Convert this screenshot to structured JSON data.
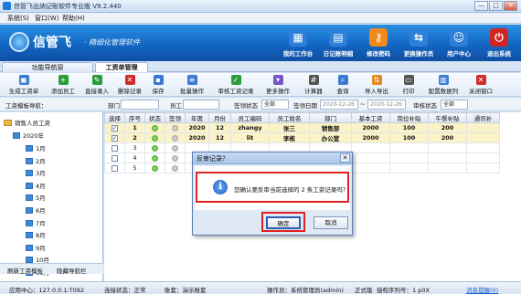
{
  "window": {
    "title": "信管飞出纳记账软件专业版 V9.2.440",
    "btn_min": "—",
    "btn_max": "□",
    "btn_close": "✕"
  },
  "menu": [
    "系统(S)",
    "窗口(W)",
    "帮助(H)"
  ],
  "banner": {
    "brand": "信管飞",
    "slogan": "· 精细化管理软件",
    "nav": [
      {
        "label": "我的工作台",
        "icon": "monitor-icon",
        "glyph": "▦",
        "color": "#2e7fd9"
      },
      {
        "label": "日记账明细",
        "icon": "ledger-icon",
        "glyph": "▤",
        "color": "#2e7fd9"
      },
      {
        "label": "修改密码",
        "icon": "lock-icon",
        "glyph": "⚷",
        "color": "#f08a1c"
      },
      {
        "label": "更换操作员",
        "icon": "switch-user-icon",
        "glyph": "⇆",
        "color": "#2e7fd9"
      },
      {
        "label": "用户中心",
        "icon": "user-center-icon",
        "glyph": "☺",
        "color": "#2e7fd9"
      },
      {
        "label": "退出系统",
        "icon": "power-icon",
        "glyph": "⏻",
        "color": "#d32424"
      }
    ]
  },
  "tabs": [
    {
      "label": "功能导航窗",
      "active": false
    },
    {
      "label": "工资单管理",
      "active": true
    }
  ],
  "toolbar": [
    {
      "label": "生成工资单",
      "icon": "generate-icon",
      "glyph": "▣",
      "color": "#3b7ad4"
    },
    {
      "label": "添加员工",
      "icon": "add-user-icon",
      "glyph": "+",
      "color": "#2a9c3a"
    },
    {
      "label": "直接录入",
      "icon": "direct-entry-icon",
      "glyph": "✎",
      "color": "#2a9c3a"
    },
    {
      "label": "删除记录",
      "icon": "delete-icon",
      "glyph": "✕",
      "color": "#d12b2b"
    },
    {
      "label": "保存",
      "icon": "save-icon",
      "glyph": "▪",
      "color": "#3b7ad4"
    },
    {
      "label": "批量操作",
      "icon": "batch-icon",
      "glyph": "≡",
      "color": "#3b7ad4"
    },
    {
      "label": "审核工资记录",
      "icon": "audit-icon",
      "glyph": "✓",
      "color": "#2a9c3a"
    },
    {
      "label": "更多操作",
      "icon": "more-icon",
      "glyph": "▾",
      "color": "#7a55c9"
    },
    {
      "label": "计算器",
      "icon": "calculator-icon",
      "glyph": "#",
      "color": "#555555"
    },
    {
      "label": "查询",
      "icon": "query-icon",
      "glyph": "⌕",
      "color": "#3b7ad4"
    },
    {
      "label": "导入导出",
      "icon": "import-export-icon",
      "glyph": "⇅",
      "color": "#e08b1a"
    },
    {
      "label": "打印",
      "icon": "print-icon",
      "glyph": "▭",
      "color": "#555555"
    },
    {
      "label": "配置数据列",
      "icon": "columns-icon",
      "glyph": "▥",
      "color": "#3b7ad4"
    },
    {
      "label": "关闭窗口",
      "icon": "close-window-icon",
      "glyph": "✕",
      "color": "#d12b2b"
    }
  ],
  "filter": {
    "template_label": "工资模板导航：",
    "dept_label": "部门",
    "emp_label": "员工",
    "sign_label": "签领状态",
    "sign_value": "全部",
    "date_label": "签领日期",
    "date_from": "2020-12-26",
    "date_to": "2020-12-26",
    "audit_label": "审核状态",
    "audit_value": "全部"
  },
  "tree": {
    "root": "销售人员工资",
    "year": "2020年",
    "months": [
      "1月",
      "2月",
      "3月",
      "4月",
      "5月",
      "6月",
      "7月",
      "8月",
      "9月",
      "10月",
      "11月"
    ]
  },
  "sidebar_bottom": {
    "refresh": "刷新工资模板",
    "hide": "隐藏导航栏"
  },
  "grid": {
    "headers": [
      "选择",
      "序号",
      "状态",
      "签领",
      "年度",
      "月份",
      "员工编码",
      "员工姓名",
      "部门",
      "基本工资",
      "岗位补贴",
      "午餐补贴",
      "通讯补"
    ],
    "rows": [
      {
        "selected": true,
        "seq": "1",
        "year": "2020",
        "month": "12",
        "code": "zhangy",
        "name": "张三",
        "dept": "销售部",
        "base": "2000",
        "post": "100",
        "lunch": "200"
      },
      {
        "selected": true,
        "seq": "2",
        "year": "2020",
        "month": "12",
        "code": "lit",
        "name": "李栋",
        "dept": "办公室",
        "base": "2000",
        "post": "100",
        "lunch": "200"
      },
      {
        "selected": false,
        "seq": "3",
        "year": "",
        "month": "",
        "code": "",
        "name": "",
        "dept": "",
        "base": "",
        "post": "",
        "lunch": ""
      },
      {
        "selected": false,
        "seq": "4",
        "year": "",
        "month": "",
        "code": "",
        "name": "",
        "dept": "",
        "base": "",
        "post": "",
        "lunch": ""
      },
      {
        "selected": false,
        "seq": "5",
        "year": "",
        "month": "",
        "code": "",
        "name": "",
        "dept": "",
        "base": "",
        "post": "",
        "lunch": ""
      }
    ]
  },
  "dialog": {
    "title": "反审记录？",
    "message": "您确认要反审当前选择的 2 条工资记录吗？",
    "ok": "确定",
    "cancel": "取消",
    "close": "✕"
  },
  "status": {
    "server": "应用中心：127.0.0.1:T092",
    "conn": "连接状态：正常",
    "account": "账套：演示账套",
    "operator": "操作员：系统管理员(admin)",
    "edition": "正式版",
    "license": "授权序列号：1 p0X",
    "message": "消息提醒(0)"
  }
}
